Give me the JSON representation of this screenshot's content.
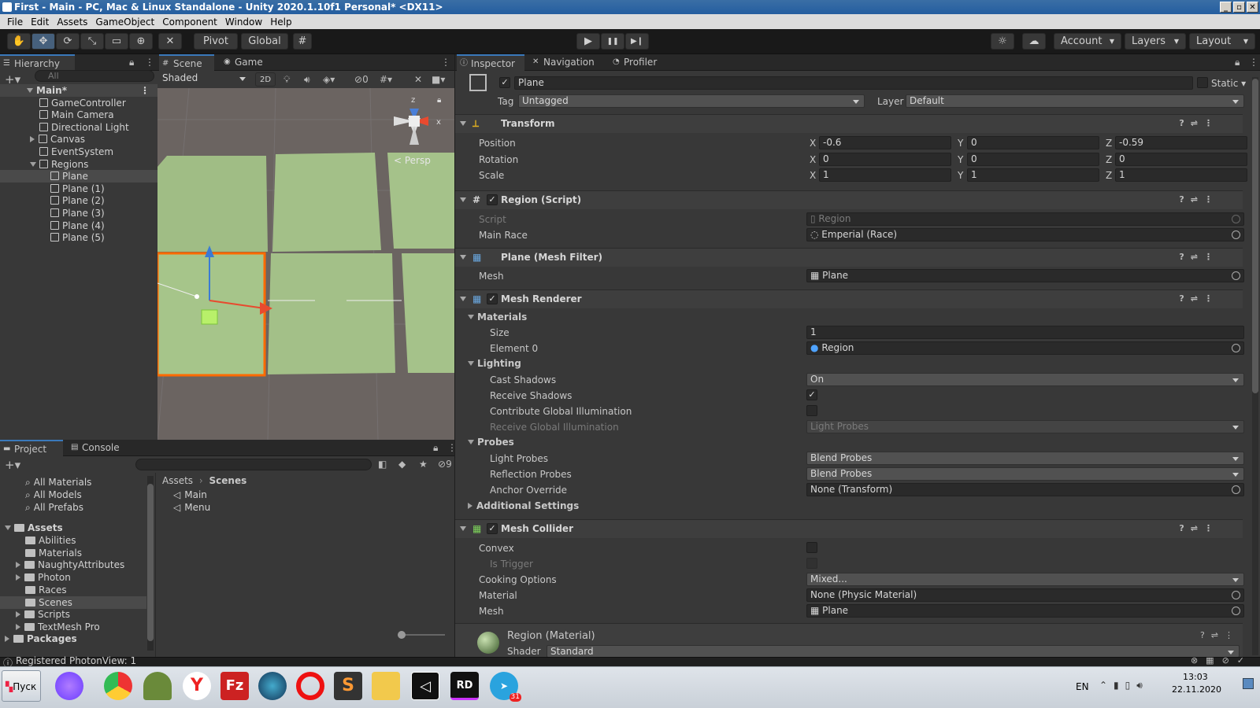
{
  "window": {
    "title": "First - Main - PC, Mac & Linux Standalone - Unity 2020.1.10f1 Personal* <DX11>",
    "buttons": [
      "_",
      "▫",
      "✕"
    ]
  },
  "menu": [
    "File",
    "Edit",
    "Assets",
    "GameObject",
    "Component",
    "Window",
    "Help"
  ],
  "toolbar": {
    "pivot": "Pivot",
    "global": "Global",
    "account": "Account",
    "layers": "Layers",
    "layout": "Layout",
    "play": "▶",
    "pause": "❚❚",
    "step": "▶❙"
  },
  "hierarchy": {
    "tab": "Hierarchy",
    "search": "All",
    "scene": "Main*",
    "items": [
      {
        "label": "GameController",
        "indent": 1,
        "arrow": ""
      },
      {
        "label": "Main Camera",
        "indent": 1,
        "arrow": ""
      },
      {
        "label": "Directional Light",
        "indent": 1,
        "arrow": ""
      },
      {
        "label": "Canvas",
        "indent": 1,
        "arrow": "right"
      },
      {
        "label": "EventSystem",
        "indent": 1,
        "arrow": ""
      },
      {
        "label": "Regions",
        "indent": 1,
        "arrow": "down"
      },
      {
        "label": "Plane",
        "indent": 2,
        "arrow": "",
        "selected": true
      },
      {
        "label": "Plane (1)",
        "indent": 2,
        "arrow": ""
      },
      {
        "label": "Plane (2)",
        "indent": 2,
        "arrow": ""
      },
      {
        "label": "Plane (3)",
        "indent": 2,
        "arrow": ""
      },
      {
        "label": "Plane (4)",
        "indent": 2,
        "arrow": ""
      },
      {
        "label": "Plane (5)",
        "indent": 2,
        "arrow": ""
      }
    ]
  },
  "scene": {
    "tabs": [
      "Scene",
      "Game"
    ],
    "shading": "Shaded",
    "mode2d": "2D",
    "hidden_count": "0",
    "persp": "< Persp",
    "gizmo_z": "z",
    "gizmo_x": "x"
  },
  "project": {
    "tabs": [
      "Project",
      "Console"
    ],
    "count": "9",
    "favorites": [
      "All Materials",
      "All Models",
      "All Prefabs"
    ],
    "assets_root": "Assets",
    "assets": [
      {
        "label": "Abilities",
        "arrow": ""
      },
      {
        "label": "Materials",
        "arrow": ""
      },
      {
        "label": "NaughtyAttributes",
        "arrow": "right"
      },
      {
        "label": "Photon",
        "arrow": "right"
      },
      {
        "label": "Races",
        "arrow": ""
      },
      {
        "label": "Scenes",
        "arrow": "",
        "selected": true
      },
      {
        "label": "Scripts",
        "arrow": "right"
      },
      {
        "label": "TextMesh Pro",
        "arrow": "right"
      }
    ],
    "packages": "Packages",
    "breadcrumb": [
      "Assets",
      "Scenes"
    ],
    "files": [
      "Main",
      "Menu"
    ]
  },
  "inspector": {
    "tabs": [
      "Inspector",
      "Navigation",
      "Profiler"
    ],
    "object_name": "Plane",
    "static_label": "Static",
    "tag_label": "Tag",
    "tag": "Untagged",
    "layer_label": "Layer",
    "layer": "Default",
    "transform": {
      "title": "Transform",
      "rows": [
        {
          "label": "Position",
          "x": "-0.6",
          "y": "0",
          "z": "-0.59"
        },
        {
          "label": "Rotation",
          "x": "0",
          "y": "0",
          "z": "0"
        },
        {
          "label": "Scale",
          "x": "1",
          "y": "1",
          "z": "1"
        }
      ]
    },
    "region": {
      "title": "Region (Script)",
      "script_label": "Script",
      "script": "Region",
      "race_label": "Main Race",
      "race": "Emperial (Race)"
    },
    "meshfilter": {
      "title": "Plane (Mesh Filter)",
      "mesh_label": "Mesh",
      "mesh": "Plane"
    },
    "renderer": {
      "title": "Mesh Renderer",
      "materials": "Materials",
      "size_label": "Size",
      "size": "1",
      "element_label": "Element 0",
      "element": "Region",
      "lighting": "Lighting",
      "cast_label": "Cast Shadows",
      "cast": "On",
      "receive_label": "Receive Shadows",
      "contrib_label": "Contribute Global Illumination",
      "rgi_label": "Receive Global Illumination",
      "rgi": "Light Probes",
      "probes": "Probes",
      "lp_label": "Light Probes",
      "lp": "Blend Probes",
      "rp_label": "Reflection Probes",
      "rp": "Blend Probes",
      "anchor_label": "Anchor Override",
      "anchor": "None (Transform)",
      "additional": "Additional Settings"
    },
    "collider": {
      "title": "Mesh Collider",
      "convex_label": "Convex",
      "trigger_label": "Is Trigger",
      "cooking_label": "Cooking Options",
      "cooking": "Mixed...",
      "material_label": "Material",
      "material": "None (Physic Material)",
      "mesh_label": "Mesh",
      "mesh": "Plane"
    },
    "material": {
      "title": "Region (Material)",
      "shader_label": "Shader",
      "shader": "Standard"
    }
  },
  "status": "Registered PhotonView: 1",
  "taskbar": {
    "start": "Пуск",
    "lang": "EN",
    "time": "13:03",
    "date": "22.11.2020",
    "badge": "31"
  },
  "colors": {
    "accent": "#3a79bb",
    "selection": "#2c5d87",
    "grid": "#6b6461",
    "plane": "#a6c58a",
    "selected_outline": "#ff6a00"
  }
}
